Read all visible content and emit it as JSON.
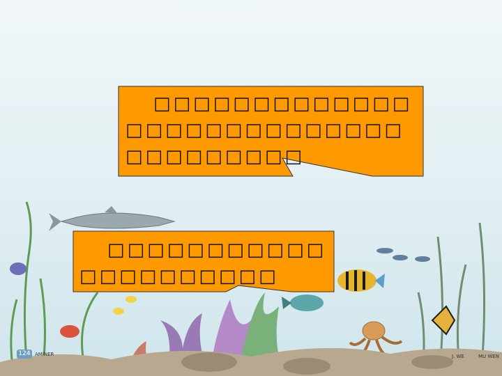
{
  "bubble_1": {
    "text": "□□□□□□□□□□□□□□□□□□□□□□□□□□□□□□□□□□□□"
  },
  "bubble_2": {
    "text": "□□□□□□□□□□□□□□□□□□□□□"
  },
  "illustration": {
    "page_number": "124",
    "publisher_mark": "AMINER",
    "credit_left": "J. WE",
    "credit_right": "MU WEN"
  },
  "colors": {
    "bubble_fill": "#ff9900",
    "sky_top": "#eef6f8",
    "water_bottom": "#cfe6ee"
  }
}
